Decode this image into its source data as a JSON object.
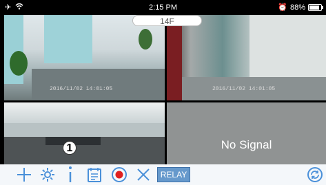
{
  "status_bar": {
    "time": "2:15 PM",
    "battery_percent": "88%",
    "battery_level": 0.88,
    "left_icons": [
      "airplane-icon",
      "wifi-icon"
    ],
    "right_icons": [
      "alarm-icon",
      "battery-icon"
    ]
  },
  "camera_view": {
    "title": "14F",
    "cells": [
      {
        "timestamp": "2016/11/02 14:01:05"
      },
      {
        "timestamp": "2016/11/02 14:01:05"
      },
      {
        "timestamp": ""
      },
      {
        "message": "No Signal"
      }
    ],
    "annotation_marker": "1"
  },
  "toolbar": {
    "relay_label": "RELAY",
    "icons": [
      "add-icon",
      "settings-gear-icon",
      "info-icon",
      "calendar-icon",
      "record-icon",
      "close-x-icon",
      "refresh-icon"
    ],
    "accent_color": "#4a90d9",
    "record_color": "#e02020"
  }
}
